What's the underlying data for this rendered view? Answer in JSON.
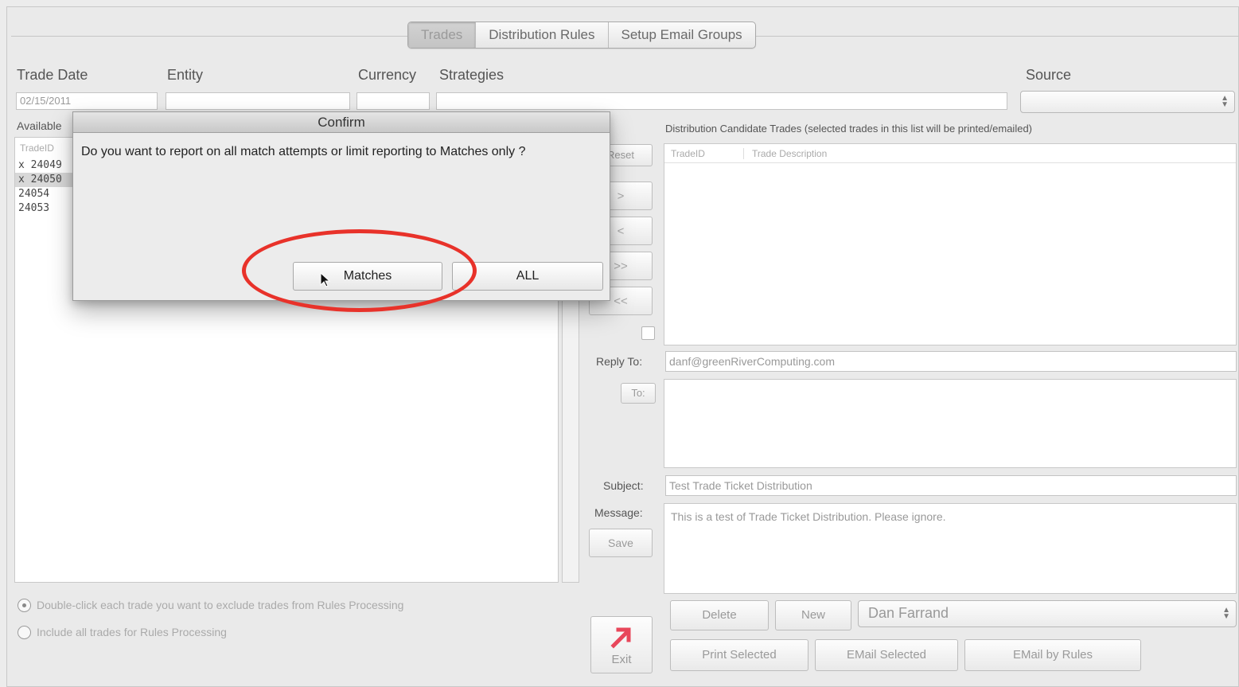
{
  "tabs": [
    {
      "label": "Trades",
      "active": true
    },
    {
      "label": "Distribution Rules",
      "active": false
    },
    {
      "label": "Setup Email Groups",
      "active": false
    }
  ],
  "filters": {
    "trade_date_label": "Trade Date",
    "trade_date_value": "02/15/2011",
    "entity_label": "Entity",
    "currency_label": "Currency",
    "strategies_label": "Strategies",
    "source_label": "Source"
  },
  "available": {
    "label": "Available",
    "column_header": "TradeID",
    "items": [
      {
        "text": "x 24049",
        "selected": false
      },
      {
        "text": "x 24050",
        "selected": true
      },
      {
        "text": "24054",
        "selected": false
      },
      {
        "text": "24053",
        "selected": false
      }
    ]
  },
  "transfer": {
    "reset_label": "Reset",
    "add_label": ">",
    "remove_label": "<",
    "add_all_label": ">>",
    "remove_all_label": "<<"
  },
  "candidates": {
    "title": "Distribution Candidate Trades (selected trades in this list will be printed/emailed)",
    "col_tradeid": "TradeID",
    "col_description": "Trade Description"
  },
  "email": {
    "reply_to_label": "Reply To:",
    "reply_to_value": "danf@greenRiverComputing.com",
    "to_button": "To:",
    "subject_label": "Subject:",
    "subject_value": "Test Trade Ticket Distribution",
    "message_label": "Message:",
    "message_value": "This is a test of Trade Ticket Distribution.  Please ignore.",
    "save_label": "Save"
  },
  "actions": {
    "delete_label": "Delete",
    "new_label": "New",
    "user_select_value": "Dan Farrand",
    "print_selected_label": "Print Selected",
    "email_selected_label": "EMail Selected",
    "email_by_rules_label": "EMail by Rules",
    "exit_label": "Exit"
  },
  "rules_options": {
    "option1": "Double-click each trade you want to exclude trades from Rules Processing",
    "option2": "Include all trades for Rules Processing",
    "selected": 1
  },
  "dialog": {
    "title": "Confirm",
    "message": "Do you want to report on all match attempts or limit reporting to Matches only ?",
    "matches_label": "Matches",
    "all_label": "ALL"
  },
  "colors": {
    "highlight": "#e8322a",
    "exit_arrow": "#e8465a"
  }
}
